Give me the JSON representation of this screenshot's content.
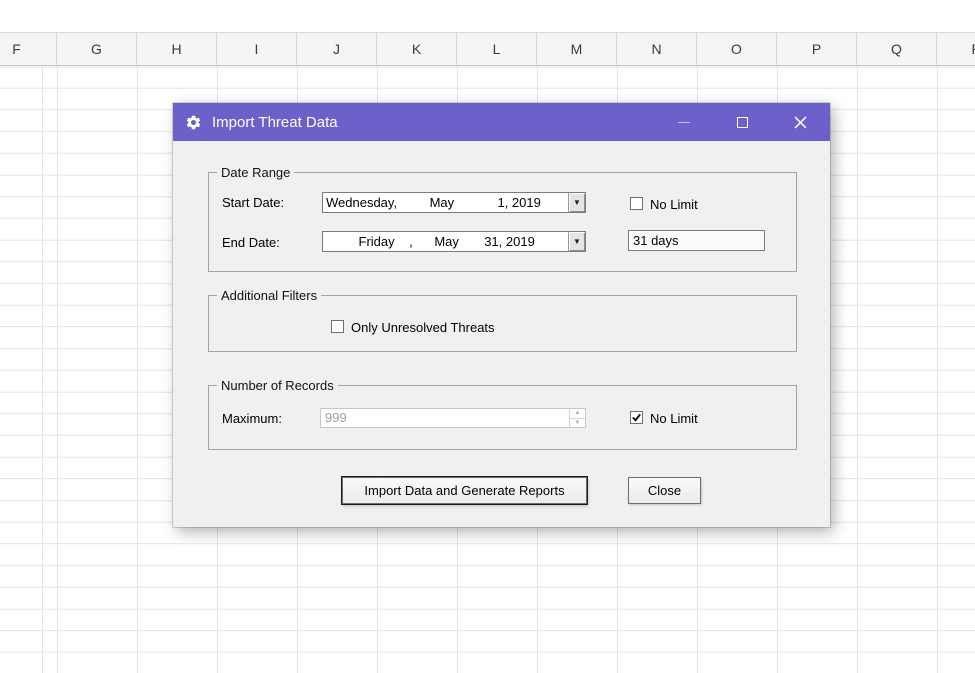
{
  "excel": {
    "columns": [
      "F",
      "G",
      "H",
      "I",
      "J",
      "K",
      "L",
      "M",
      "N",
      "O",
      "P",
      "Q",
      "R"
    ]
  },
  "icons": {
    "dropdown_arrow": "▼",
    "spin_up": "▲",
    "spin_down": "▼"
  },
  "colors": {
    "titlebar": "#6c61ca",
    "dialog_body": "#f0f0f0",
    "gridline": "#e3e3e3"
  },
  "dialog": {
    "title": "Import Threat Data",
    "date_range": {
      "legend": "Date Range",
      "start_label": "Start Date:",
      "start_value": "Wednesday,         May            1, 2019",
      "end_label": "End Date:",
      "end_value": "         Friday    ,      May       31, 2019",
      "no_limit_label": "No Limit",
      "no_limit_checked": false,
      "duration_value": "31 days"
    },
    "additional_filters": {
      "legend": "Additional Filters",
      "only_unresolved_label": "Only Unresolved Threats",
      "only_unresolved_checked": false
    },
    "number_of_records": {
      "legend": "Number of Records",
      "maximum_label": "Maximum:",
      "maximum_value": "999",
      "maximum_enabled": false,
      "no_limit_label": "No Limit",
      "no_limit_checked": true
    },
    "buttons": {
      "import": "Import Data and Generate Reports",
      "close": "Close"
    }
  }
}
